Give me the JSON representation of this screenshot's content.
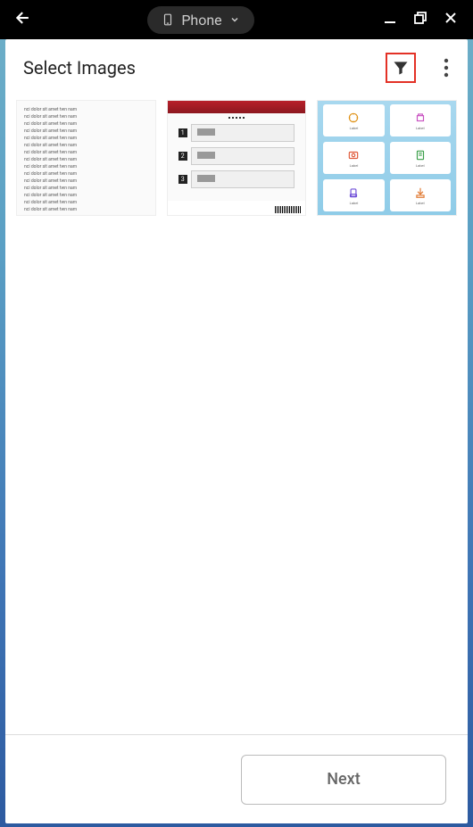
{
  "titlebar": {
    "device_label": "Phone"
  },
  "header": {
    "title": "Select Images"
  },
  "thumbnails": [
    {
      "kind": "text-document",
      "name": "image-thumb-1"
    },
    {
      "kind": "instruction-sheet",
      "name": "image-thumb-2"
    },
    {
      "kind": "app-icon-grid",
      "name": "image-thumb-3"
    }
  ],
  "footer": {
    "next_label": "Next"
  },
  "highlight": {
    "target": "filter-button",
    "color": "#e33126"
  }
}
